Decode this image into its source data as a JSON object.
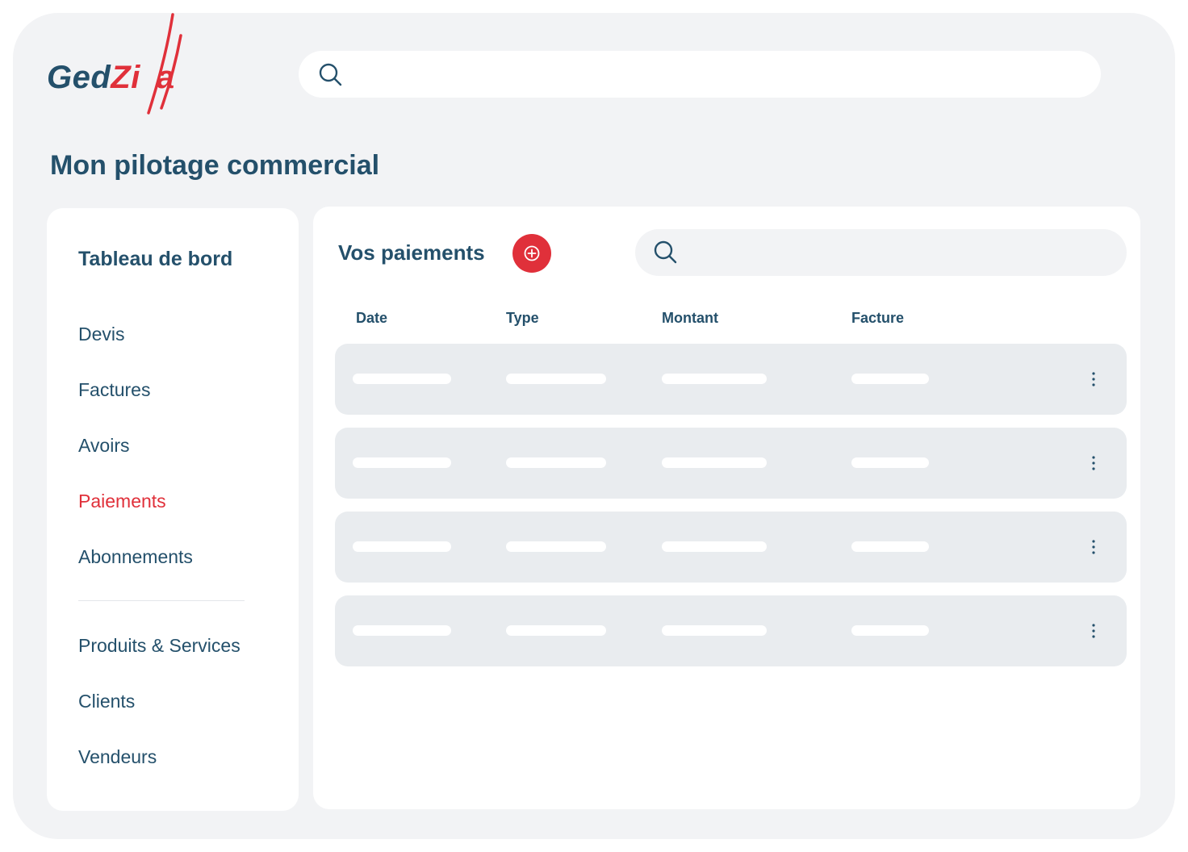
{
  "app": {
    "logo_text": "GedZilla",
    "logo_part1": "Ged",
    "logo_part2": "Zi",
    "logo_part3": "a",
    "brand_color": "#24506b",
    "accent_color": "#e0303a"
  },
  "header": {
    "search_icon": "search-icon",
    "search_value": ""
  },
  "page": {
    "title": "Mon pilotage commercial"
  },
  "sidebar": {
    "title": "Tableau de bord",
    "items": [
      {
        "label": "Devis",
        "active": false
      },
      {
        "label": "Factures",
        "active": false
      },
      {
        "label": "Avoirs",
        "active": false
      },
      {
        "label": "Paiements",
        "active": true
      },
      {
        "label": "Abonnements",
        "active": false
      }
    ],
    "secondary_items": [
      {
        "label": "Produits & Services"
      },
      {
        "label": "Clients"
      },
      {
        "label": "Vendeurs"
      }
    ]
  },
  "main": {
    "title": "Vos paiements",
    "add_icon": "plus-circle-icon",
    "search_icon": "search-icon",
    "search_value": "",
    "columns": [
      "Date",
      "Type",
      "Montant",
      "Facture"
    ],
    "rows": [
      {
        "placeholder": true,
        "menu_icon": "more-vertical-icon"
      },
      {
        "placeholder": true,
        "menu_icon": "more-vertical-icon"
      },
      {
        "placeholder": true,
        "menu_icon": "more-vertical-icon"
      },
      {
        "placeholder": true,
        "menu_icon": "more-vertical-icon"
      }
    ]
  }
}
